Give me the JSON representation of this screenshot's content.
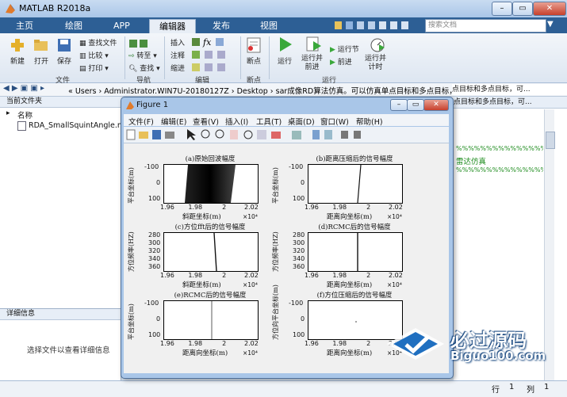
{
  "app": {
    "title": "MATLAB R2018a"
  },
  "tabs": [
    "主页",
    "绘图",
    "APP",
    "编辑器",
    "发布",
    "视图"
  ],
  "search": {
    "placeholder": "搜索文档"
  },
  "ribbon": {
    "file": {
      "new": "新建",
      "open": "打开",
      "save": "保存",
      "find_files": "查找文件",
      "compare": "比较",
      "print": "打印",
      "group": "文件"
    },
    "nav": {
      "goto": "转至",
      "find": "查找",
      "group": "导航"
    },
    "edit": {
      "insert": "插入",
      "comment": "注释",
      "indent": "缩进",
      "group": "编辑"
    },
    "breakpoints": {
      "label": "断点",
      "group": "断点"
    },
    "run": {
      "run": "运行",
      "run_advance": "运行并\n前进",
      "run_section": "运行节",
      "advance": "前进",
      "run_time": "运行并\n计时",
      "group": "运行"
    }
  },
  "address": {
    "path": "« Users › Administrator.WIN7U-20180127Z › Desktop › sar成像RD算法仿真。可以仿真单点目标和多点目标，可以添加方位向相位噪声"
  },
  "current_folder": {
    "title": "当前文件夹",
    "column": "名称",
    "files": [
      "RDA_SmallSquintAngle.m"
    ]
  },
  "details": {
    "title": "详细信息",
    "empty_text": "选择文件以查看详细信息"
  },
  "editor_snippets": {
    "line1": "点目标和多点目标，可...",
    "comment_row": "%%%%%%%%%%%%%%%%%%%%%%%%",
    "text1": "雷达仿真"
  },
  "status": {
    "row_label": "行",
    "row": "1",
    "col_label": "列",
    "col": "1"
  },
  "watermark": {
    "brand": "必过源码",
    "url": "Biguo100.com"
  },
  "figure": {
    "title": "Figure 1",
    "menu": [
      "文件(F)",
      "编辑(E)",
      "查看(V)",
      "插入(I)",
      "工具(T)",
      "桌面(D)",
      "窗口(W)",
      "帮助(H)"
    ],
    "plots": [
      {
        "title": "(a)原始回波幅度",
        "xlabel": "斜距坐标(m)",
        "ylabel": "平台坐标(m)",
        "xticks": [
          "1.96",
          "1.98",
          "2",
          "2.02"
        ],
        "yticks": [
          "-100",
          "0",
          "100"
        ],
        "exp": "×10⁴"
      },
      {
        "title": "(b)距离压缩后的信号幅度",
        "xlabel": "距离向坐标(m)",
        "ylabel": "平台坐标(m)",
        "xticks": [
          "1.96",
          "1.98",
          "2",
          "2.02"
        ],
        "yticks": [
          "-100",
          "0",
          "100"
        ],
        "exp": "×10⁴"
      },
      {
        "title": "(c)方位fft后的信号幅度",
        "xlabel": "斜距坐标(m)",
        "ylabel": "方位频率(HZ)",
        "xticks": [
          "1.96",
          "1.98",
          "2",
          "2.02"
        ],
        "yticks": [
          "280",
          "300",
          "320",
          "340",
          "360"
        ],
        "exp": "×10⁴"
      },
      {
        "title": "(d)RCMC后的信号幅度",
        "xlabel": "距离向坐标(m)",
        "ylabel": "方位频率(HZ)",
        "xticks": [
          "1.96",
          "1.98",
          "2",
          "2.02"
        ],
        "yticks": [
          "280",
          "300",
          "320",
          "340",
          "360"
        ],
        "exp": "×10⁴"
      },
      {
        "title": "(e)RCMC后的信号幅度",
        "xlabel": "距离向坐标(m)",
        "ylabel": "平台坐标(m)",
        "xticks": [
          "1.96",
          "1.98",
          "2",
          "2.02"
        ],
        "yticks": [
          "-100",
          "0",
          "100"
        ],
        "exp": "×10⁴"
      },
      {
        "title": "(f)方位压缩后的信号幅度",
        "xlabel": "距离向坐标(m)",
        "ylabel": "方位向平台坐标(m)",
        "xticks": [
          "1.96",
          "1.98",
          "2",
          "2.02"
        ],
        "yticks": [
          "-100",
          "0",
          "100"
        ],
        "exp": "×10⁴"
      }
    ]
  }
}
